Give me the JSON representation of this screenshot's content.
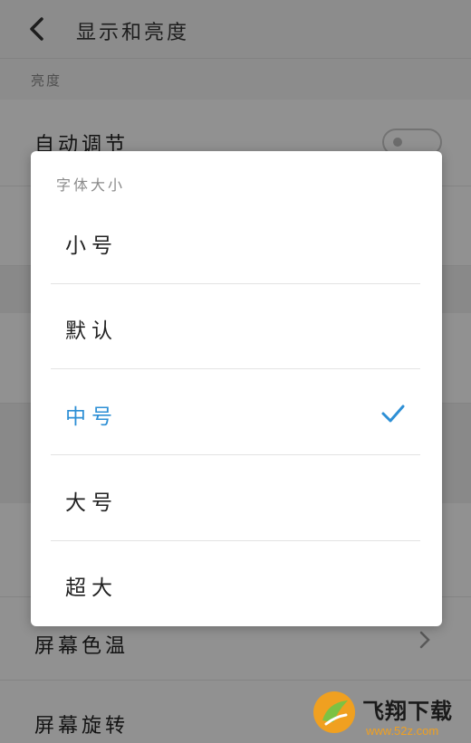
{
  "header": {
    "title": "显示和亮度"
  },
  "brightness": {
    "section_label": "亮度",
    "auto_label": "自动调节"
  },
  "rows": {
    "screen_color_temp": "屏幕色温",
    "screen_rotation": "屏幕旋转"
  },
  "dialog": {
    "title": "字体大小",
    "options": [
      {
        "label": "小号",
        "selected": false
      },
      {
        "label": "默认",
        "selected": false
      },
      {
        "label": "中号",
        "selected": true
      },
      {
        "label": "大号",
        "selected": false
      },
      {
        "label": "超大",
        "selected": false
      }
    ]
  },
  "watermark": {
    "name": "飞翔下载",
    "url": "www.52z.com"
  },
  "colors": {
    "accent": "#2d8fd5",
    "overlay": "rgba(0,0,0,0.42)"
  },
  "icons": {
    "back": "chevron-left-icon",
    "check": "check-icon",
    "row_arrow": "chevron-right-icon"
  }
}
